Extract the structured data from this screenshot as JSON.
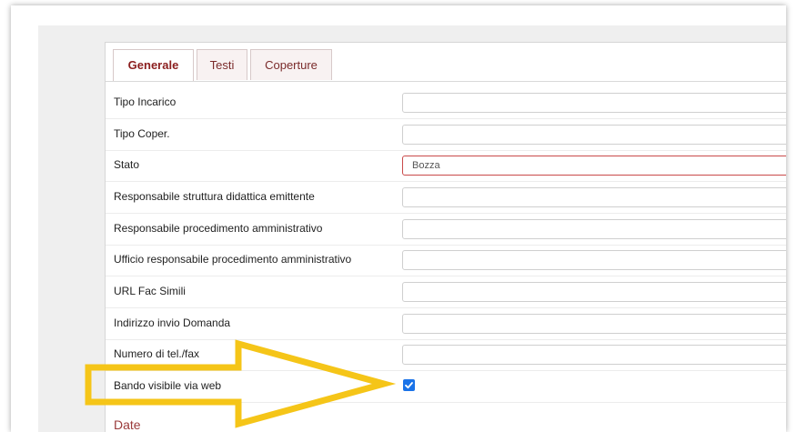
{
  "tabs": [
    {
      "label": "Generale",
      "active": true
    },
    {
      "label": "Testi",
      "active": false
    },
    {
      "label": "Coperture",
      "active": false
    }
  ],
  "form": {
    "rows": [
      {
        "label": "Tipo Incarico",
        "value": ""
      },
      {
        "label": "Tipo Coper.",
        "value": ""
      },
      {
        "label": "Stato",
        "value": "Bozza"
      },
      {
        "label": "Responsabile struttura didattica emittente",
        "value": ""
      },
      {
        "label": "Responsabile procedimento amministrativo",
        "value": ""
      },
      {
        "label": "Ufficio responsabile procedimento amministrativo",
        "value": ""
      },
      {
        "label": "URL Fac Simili",
        "value": ""
      },
      {
        "label": "Indirizzo invio Domanda",
        "value": ""
      },
      {
        "label": "Numero di tel./fax",
        "value": ""
      }
    ],
    "bando": {
      "label": "Bando visibile via web",
      "checked": true
    },
    "date_label": "Date"
  },
  "colors": {
    "accent": "#8b1e1e",
    "highlight_arrow": "#f5c518",
    "checkbox": "#1a73e8",
    "error_border": "#c94a4a"
  }
}
